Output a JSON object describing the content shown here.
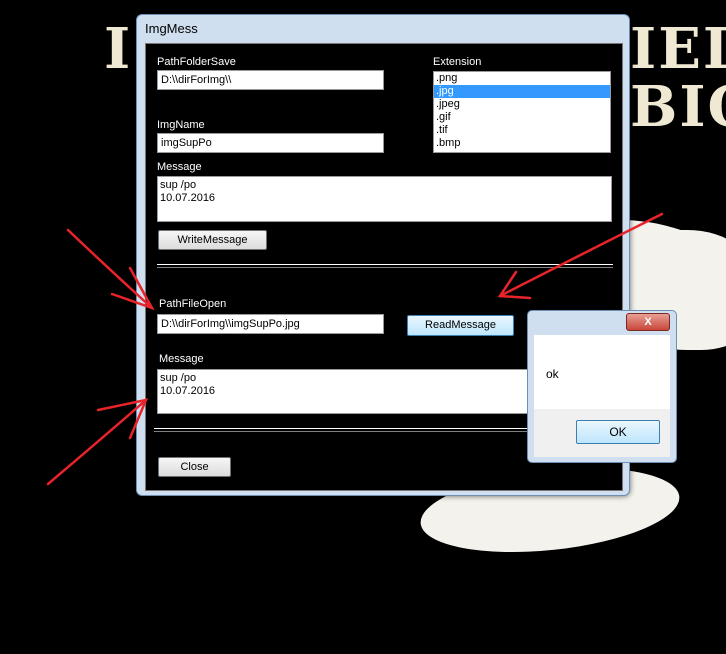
{
  "background": {
    "text_line1": "I",
    "text_line1_right": "IED",
    "text_line2_right": "BIC"
  },
  "window": {
    "title": "ImgMess",
    "path_folder_save_label": "PathFolderSave",
    "path_folder_save_value": "D:\\\\dirForImg\\\\",
    "extension_label": "Extension",
    "extensions": [
      ".png",
      ".jpg",
      ".jpeg",
      ".gif",
      ".tif",
      ".bmp"
    ],
    "selected_extension": ".jpg",
    "img_name_label": "ImgName",
    "img_name_value": "imgSupPo",
    "message_label_1": "Message",
    "message_1_line1": "sup /po",
    "message_1_line2": "10.07.2016",
    "write_message_button": "WriteMessage",
    "path_file_open_label": "PathFileOpen",
    "path_file_open_value": "D:\\\\dirForImg\\\\imgSupPo.jpg",
    "read_message_button": "ReadMessage",
    "message_label_2": "Message",
    "message_2_line1": "sup /po",
    "message_2_line2": "10.07.2016",
    "close_button": "Close"
  },
  "message_box": {
    "close_glyph": "X",
    "text": "ok",
    "ok_button": "OK"
  },
  "colors": {
    "annotation": "#e8232a",
    "selection": "#3399ff"
  }
}
